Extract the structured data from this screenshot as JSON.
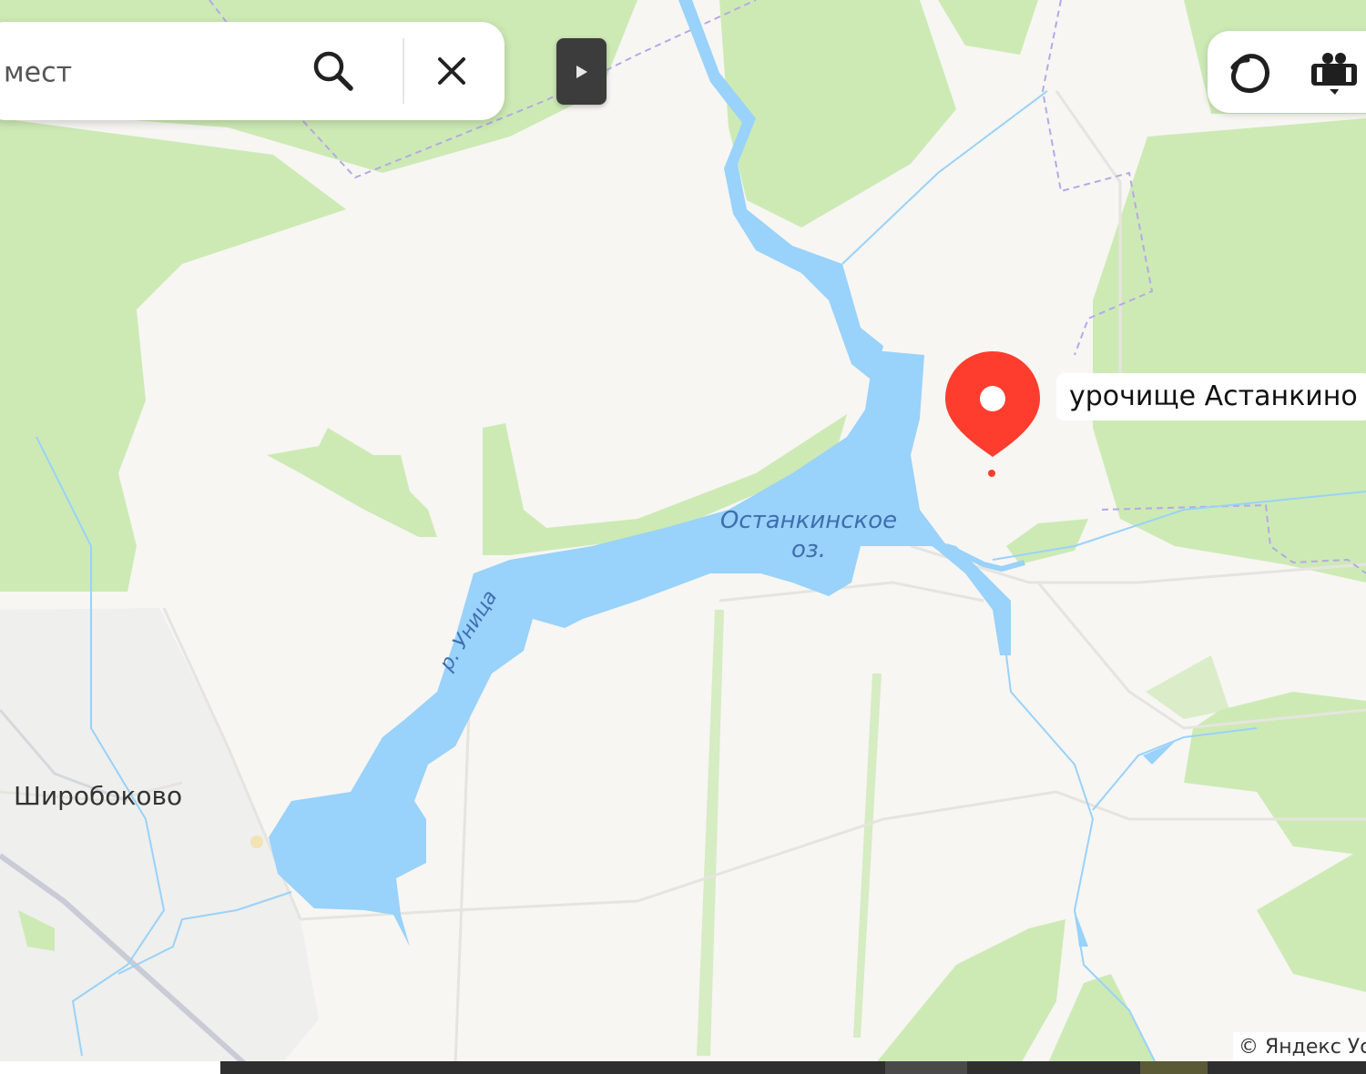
{
  "search": {
    "value": "мест",
    "search_icon": "magnifier-icon",
    "clear_icon": "close-icon"
  },
  "collapse_panel": {
    "icon": "play-triangle-icon"
  },
  "controls": {
    "alice_icon": "alice-ring-icon",
    "panorama_icon": "panorama-people-icon"
  },
  "marker": {
    "label": "урочище Астанкино",
    "icon": "map-pin-icon",
    "color": "#ff3d2e"
  },
  "map_labels": {
    "lake_line1": "Останкинское",
    "lake_line2": "оз.",
    "river": "р. Уница",
    "village": "Широбоково"
  },
  "footer": {
    "copyright": "© Яндекс  Ус"
  },
  "colors": {
    "water": "#99d2fa",
    "forest": "#cdeab5",
    "land": "#f7f6f3",
    "pin": "#ff3d2e"
  }
}
